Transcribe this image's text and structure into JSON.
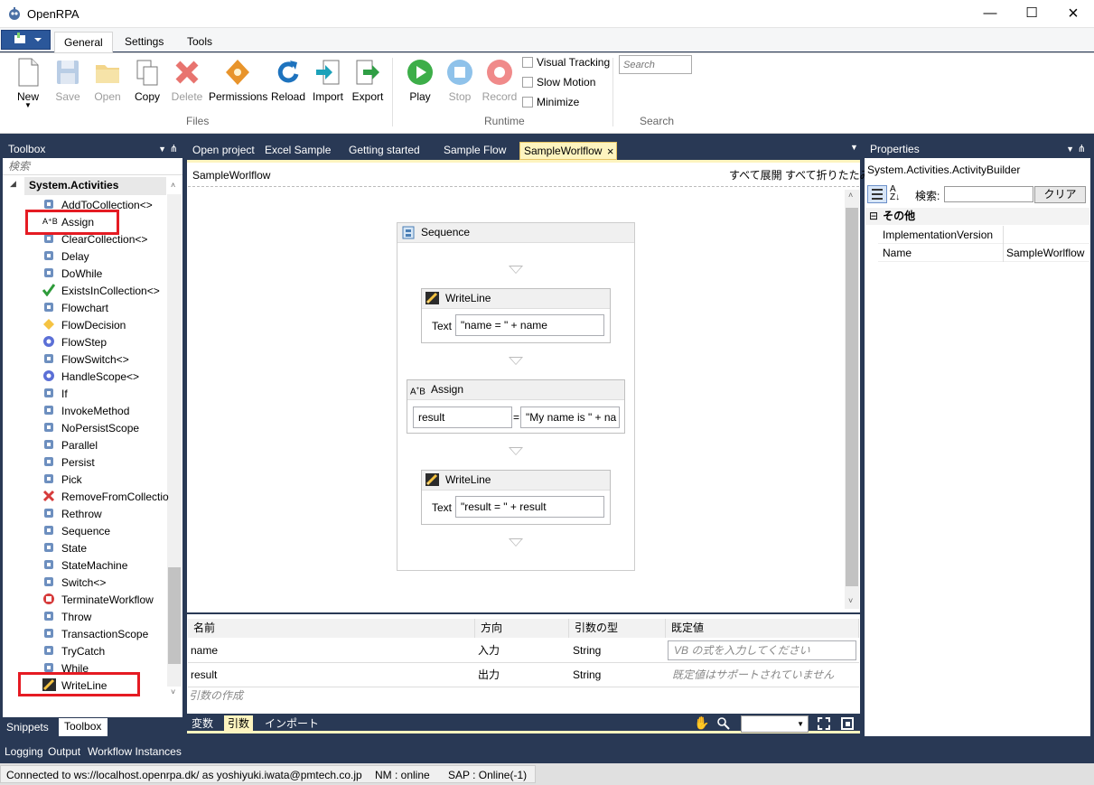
{
  "app": {
    "title": "OpenRPA"
  },
  "ribbon": {
    "tabs": [
      {
        "label": "General"
      },
      {
        "label": "Settings"
      },
      {
        "label": "Tools"
      }
    ],
    "files_buttons": [
      {
        "label": "New"
      },
      {
        "label": "Save"
      },
      {
        "label": "Open"
      },
      {
        "label": "Copy"
      },
      {
        "label": "Delete"
      },
      {
        "label": "Permissions"
      },
      {
        "label": "Reload"
      },
      {
        "label": "Import"
      },
      {
        "label": "Export"
      }
    ],
    "runtime_buttons": [
      {
        "label": "Play"
      },
      {
        "label": "Stop"
      },
      {
        "label": "Record"
      }
    ],
    "checkboxes": [
      {
        "label": "Visual Tracking"
      },
      {
        "label": "Slow Motion"
      },
      {
        "label": "Minimize"
      }
    ],
    "groups": {
      "files": "Files",
      "runtime": "Runtime",
      "search": "Search"
    },
    "search_placeholder": "Search"
  },
  "toolbox": {
    "title": "Toolbox",
    "search_placeholder": "検索",
    "category": "System.Activities",
    "items": [
      {
        "label": "AddToCollection<>",
        "icon": "collection-add-icon"
      },
      {
        "label": "Assign",
        "icon": "assign-icon"
      },
      {
        "label": "ClearCollection<>",
        "icon": "collection-clear-icon"
      },
      {
        "label": "Delay",
        "icon": "delay-clock-icon"
      },
      {
        "label": "DoWhile",
        "icon": "dowhile-icon"
      },
      {
        "label": "ExistsInCollection<>",
        "icon": "checkmark-icon"
      },
      {
        "label": "Flowchart",
        "icon": "flowchart-icon"
      },
      {
        "label": "FlowDecision",
        "icon": "diamond-icon"
      },
      {
        "label": "FlowStep",
        "icon": "gear-icon"
      },
      {
        "label": "FlowSwitch<>",
        "icon": "switch-icon"
      },
      {
        "label": "HandleScope<>",
        "icon": "gear-icon"
      },
      {
        "label": "If",
        "icon": "if-icon"
      },
      {
        "label": "InvokeMethod",
        "icon": "invoke-icon"
      },
      {
        "label": "NoPersistScope",
        "icon": "nopersist-icon"
      },
      {
        "label": "Parallel",
        "icon": "parallel-icon"
      },
      {
        "label": "Persist",
        "icon": "persist-icon"
      },
      {
        "label": "Pick",
        "icon": "pick-icon"
      },
      {
        "label": "RemoveFromCollectio",
        "icon": "remove-x-icon"
      },
      {
        "label": "Rethrow",
        "icon": "rethrow-icon"
      },
      {
        "label": "Sequence",
        "icon": "sequence-icon"
      },
      {
        "label": "State",
        "icon": "state-icon"
      },
      {
        "label": "StateMachine",
        "icon": "statemachine-icon"
      },
      {
        "label": "Switch<>",
        "icon": "switch-icon"
      },
      {
        "label": "TerminateWorkflow",
        "icon": "terminate-icon"
      },
      {
        "label": "Throw",
        "icon": "throw-icon"
      },
      {
        "label": "TransactionScope",
        "icon": "transaction-icon"
      },
      {
        "label": "TryCatch",
        "icon": "trycatch-icon"
      },
      {
        "label": "While",
        "icon": "while-icon"
      },
      {
        "label": "WriteLine",
        "icon": "writeline-icon"
      }
    ],
    "bottom_tabs": [
      {
        "label": "Snippets"
      },
      {
        "label": "Toolbox"
      }
    ]
  },
  "designer": {
    "tabs": [
      {
        "label": "Open project"
      },
      {
        "label": "Excel Sample"
      },
      {
        "label": "Getting started"
      },
      {
        "label": "Sample Flow"
      },
      {
        "label": "SampleWorlflow"
      }
    ],
    "breadcrumb": "SampleWorlflow",
    "expand_all": "すべて展開",
    "collapse_all": "すべて折りたたみ",
    "sequence_title": "Sequence",
    "writeline1": {
      "title": "WriteLine",
      "text_label": "Text",
      "value": "\"name = \" + name"
    },
    "assign": {
      "title": "Assign",
      "to": "result",
      "eq": "=",
      "value": "\"My name is \" + na"
    },
    "writeline2": {
      "title": "WriteLine",
      "text_label": "Text",
      "value": "\"result = \" + result"
    }
  },
  "arguments": {
    "headers": [
      "名前",
      "方向",
      "引数の型",
      "既定値"
    ],
    "rows": [
      {
        "name": "name",
        "direction": "入力",
        "type": "String",
        "default": "VB の式を入力してください"
      },
      {
        "name": "result",
        "direction": "出力",
        "type": "String",
        "default": "既定値はサポートされていません"
      }
    ],
    "create": "引数の作成"
  },
  "designbar": {
    "tabs": [
      {
        "label": "変数"
      },
      {
        "label": "引数"
      },
      {
        "label": "インポート"
      }
    ]
  },
  "properties": {
    "title": "Properties",
    "type": "System.Activities.ActivityBuilder",
    "search_label": "検索:",
    "clear": "クリア",
    "category": "その他",
    "rows": [
      {
        "name": "ImplementationVersion",
        "value": ""
      },
      {
        "name": "Name",
        "value": "SampleWorlflow"
      }
    ]
  },
  "bottom_tabs": [
    {
      "label": "Logging"
    },
    {
      "label": "Output"
    },
    {
      "label": "Workflow Instances"
    }
  ],
  "status": {
    "connection": "Connected to ws://localhost.openrpa.dk/ as yoshiyuki.iwata@pmtech.co.jp",
    "nm": "NM : online",
    "sap": "SAP : Online(-1)"
  },
  "colors": {
    "accent": "#2b579a",
    "panel": "#293955",
    "active_tab": "#fdf4bf",
    "highlight": "#e51b23"
  }
}
